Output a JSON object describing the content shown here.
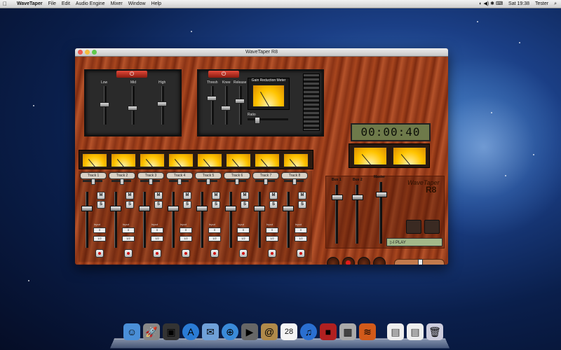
{
  "menubar": {
    "app_name": "WaveTaper",
    "items": [
      "File",
      "Edit",
      "Audio Engine",
      "Mixer",
      "Window",
      "Help"
    ],
    "clock": "Sat 19:38",
    "user": "Tester"
  },
  "window": {
    "title": "WaveTaper R8",
    "traffic_colors": [
      "#ee5a50",
      "#f5be3d",
      "#5fc94c"
    ]
  },
  "eq": {
    "power_label": "⏻",
    "labels": [
      "Low",
      "Mid",
      "High"
    ]
  },
  "compressor": {
    "power_label": "⏻",
    "labels": [
      "Thresh",
      "Knee",
      "Release",
      "Ratio"
    ],
    "meter_title": "Gain Reduction Meter"
  },
  "counter": {
    "time": "00:00:40"
  },
  "tracks": [
    {
      "label": "Track 1",
      "input": "Input",
      "channel": "1/2"
    },
    {
      "label": "Track 2",
      "input": "Input",
      "channel": "1/2"
    },
    {
      "label": "Track 3",
      "input": "Input",
      "channel": "1/2"
    },
    {
      "label": "Track 4",
      "input": "Input",
      "channel": "1/2"
    },
    {
      "label": "Track 5",
      "input": "Input",
      "channel": "1/2"
    },
    {
      "label": "Track 6",
      "input": "Input",
      "channel": "1/2"
    },
    {
      "label": "Track 7",
      "input": "Input",
      "channel": "1/2"
    },
    {
      "label": "Track 8",
      "input": "Input",
      "channel": "1/2"
    }
  ],
  "mute_label": "M",
  "solo_label": "S",
  "bus": {
    "bus1": "Bus 1",
    "bus2": "Bus 2",
    "master": "Master",
    "brand_line1": "WaveTaper",
    "brand_line2": "R8",
    "play_label": "▷I PLAY"
  },
  "dock": {
    "icons": [
      "finder-icon",
      "launchpad-icon",
      "photo-booth-icon",
      "app-store-icon",
      "mail-icon",
      "safari-icon",
      "facetime-icon",
      "contacts-icon",
      "calendar-icon",
      "itunes-icon",
      "photo-icon",
      "preview-icon",
      "wavetaper-icon",
      "document-icon",
      "document2-icon",
      "trash-icon"
    ],
    "calendar_day": "28"
  }
}
